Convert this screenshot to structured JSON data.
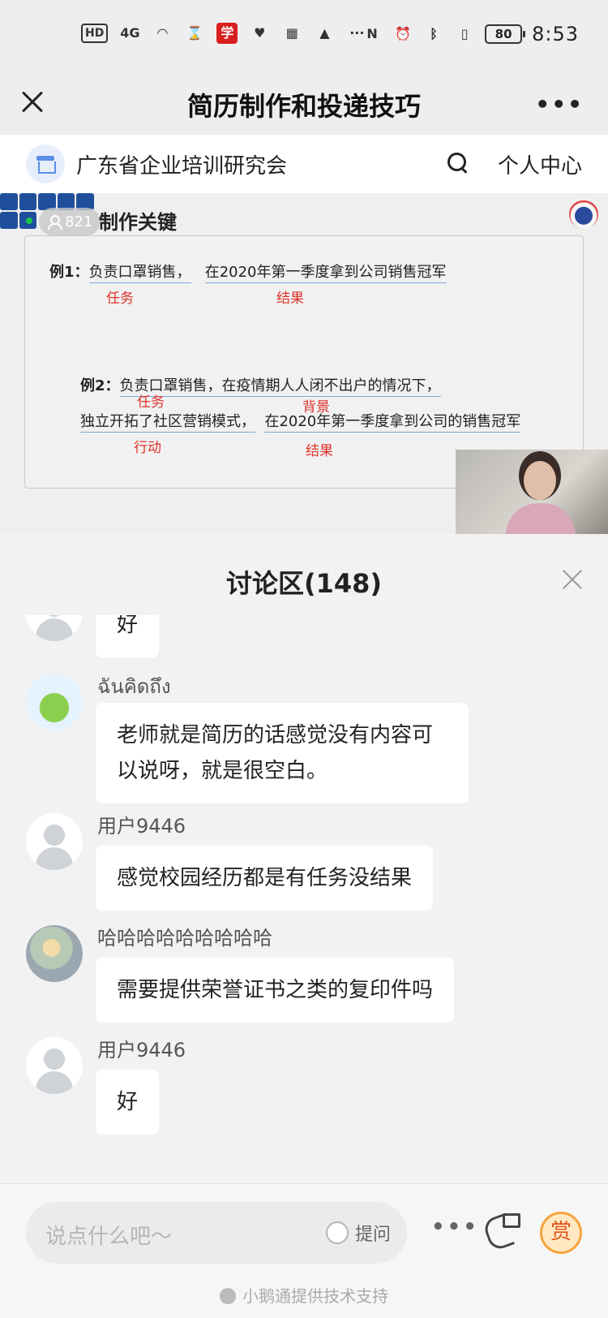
{
  "status_bar": {
    "network_hd": "HD",
    "network_4g": "4G",
    "battery": "80",
    "time": "8:53"
  },
  "title_bar": {
    "title": "简历制作和投递技巧",
    "more": "•••"
  },
  "org": {
    "name": "广东省企业培训研究会",
    "personal_center": "个人中心"
  },
  "video": {
    "slide_title": "制作关键",
    "viewers": "821",
    "example1": {
      "prefix": "例1",
      "text_a": "负责口罩销售，",
      "text_b": "在2020年第一季度拿到公司销售冠军",
      "tag_task": "任务",
      "tag_result": "结果"
    },
    "example2": {
      "prefix": "例2",
      "line1_a": "负责口罩销售，",
      "line1_b": "在疫情期人人闭不出户的情况下，",
      "line2_a": "独立开拓了社区营销模式，",
      "line2_b": "在2020年第一季度拿到公司的销售冠军",
      "tag_task": "任务",
      "tag_background": "背景",
      "tag_action": "行动",
      "tag_result": "结果"
    }
  },
  "discussion": {
    "title": "讨论区(148)",
    "messages": [
      {
        "name": "",
        "text": "好",
        "avatar": "default-icon"
      },
      {
        "name": "ฉันคิดถึง",
        "text": "老师就是简历的话感觉没有内容可以说呀，就是很空白。",
        "avatar": "frog-avatar"
      },
      {
        "name": "用户9446",
        "text": "感觉校园经历都是有任务没结果",
        "avatar": "default-icon"
      },
      {
        "name": "哈哈哈哈哈哈哈哈哈",
        "text": "需要提供荣誉证书之类的复印件吗",
        "avatar": "photo-avatar"
      },
      {
        "name": "用户9446",
        "text": "好",
        "avatar": "default-icon"
      }
    ]
  },
  "footer": {
    "placeholder": "说点什么吧～",
    "ask_label": "提问",
    "more": "•••",
    "reward": "赏",
    "powered_by": "小鹅通提供技术支持"
  }
}
